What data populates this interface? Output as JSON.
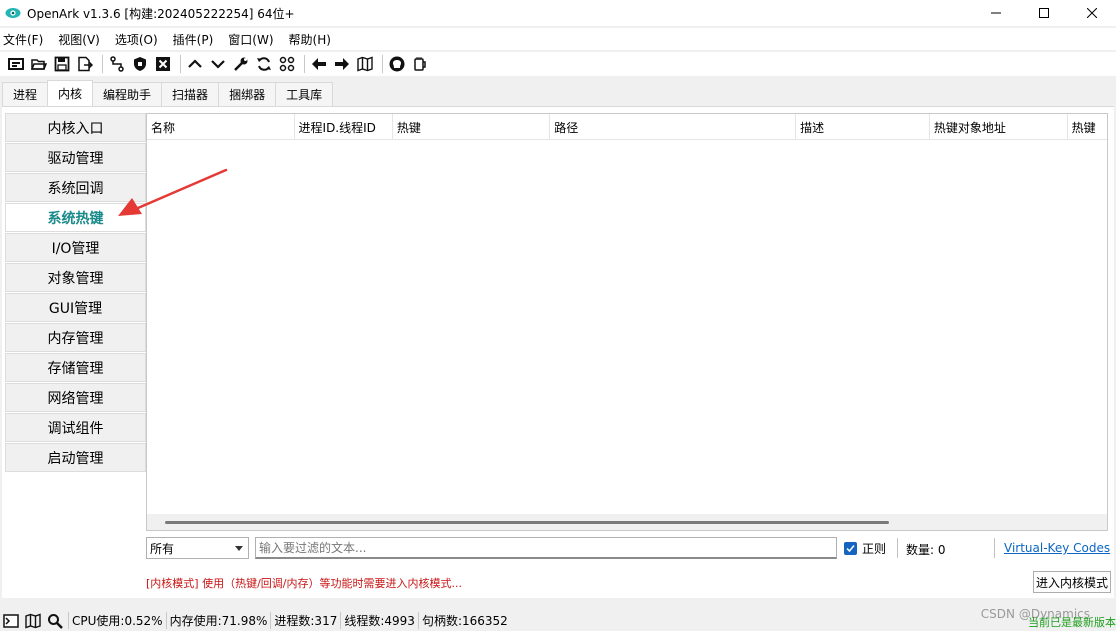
{
  "window": {
    "title": "OpenArk v1.3.6 [构建:202405222254]  64位+",
    "icon": "eye-logo-icon"
  },
  "menu": [
    "文件(F)",
    "视图(V)",
    "选项(O)",
    "插件(P)",
    "窗口(W)",
    "帮助(H)"
  ],
  "tabs": [
    "进程",
    "内核",
    "编程助手",
    "扫描器",
    "捆绑器",
    "工具库"
  ],
  "active_tab": "内核",
  "sidebar": {
    "items": [
      "内核入口",
      "驱动管理",
      "系统回调",
      "系统热键",
      "I/O管理",
      "对象管理",
      "GUI管理",
      "内存管理",
      "存储管理",
      "网络管理",
      "调试组件",
      "启动管理"
    ],
    "active": "系统热键"
  },
  "table": {
    "columns": [
      "名称",
      "进程ID.线程ID",
      "热键",
      "路径",
      "描述",
      "热键对象地址",
      "热键"
    ]
  },
  "filter": {
    "select_value": "所有",
    "placeholder": "输入要过滤的文本...",
    "regex_label": "正则",
    "count_label": "数量: 0",
    "link_label": "Virtual-Key Codes"
  },
  "notice": "[内核模式] 使用（热键/回调/内存）等功能时需要进入内核模式...",
  "enter_kernel_button": "进入内核模式",
  "status": {
    "cpu": "CPU使用:0.52%",
    "mem": "内存使用:71.98%",
    "procs": "进程数:317",
    "threads": "线程数:4993",
    "handles": "句柄数:166352",
    "watermark": "CSDN @Dynamics",
    "update": "当前已是最新版本"
  },
  "colors": {
    "accent": "#1a8a8a",
    "link": "#0b66c2",
    "notice": "#c81414",
    "annotation_arrow": "#e53935"
  }
}
